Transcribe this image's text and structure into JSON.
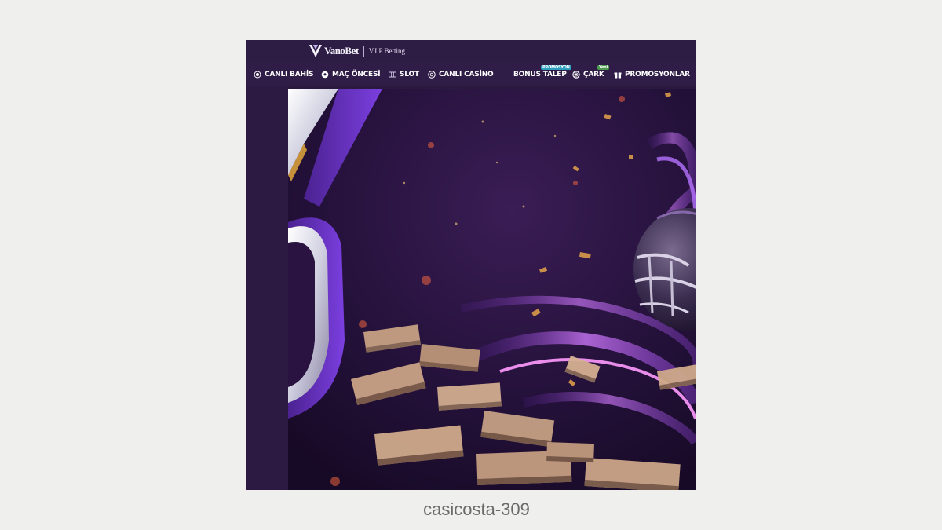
{
  "brand": {
    "name": "VanoBet",
    "tagline": "V.I.P Betting"
  },
  "nav": {
    "items": [
      {
        "label": "CANLI BAHİS",
        "icon": "live-dot-icon"
      },
      {
        "label": "MAÇ ÖNCESİ",
        "icon": "soccer-ball-icon"
      },
      {
        "label": "SLOT",
        "icon": "slot-icon"
      },
      {
        "label": "CANLI CASİNO",
        "icon": "casino-chip-icon"
      },
      {
        "label": "BONUS TALEP",
        "badge": "PROMOSYON"
      },
      {
        "label": "ÇARK",
        "icon": "wheel-icon",
        "badge": "Yeni"
      },
      {
        "label": "PROMOSYONLAR",
        "icon": "gift-icon"
      }
    ]
  },
  "banner": {
    "image": "sports betting promo art with purple swirl, money stacks and football helmet"
  },
  "caption": "casicosta-309",
  "colors": {
    "page_bg": "#eff0ee",
    "header_bg": "#2d1c44",
    "accent_purple": "#8a3fd6",
    "badge_blue": "#2f9fc0",
    "badge_green": "#4a9a4c"
  }
}
